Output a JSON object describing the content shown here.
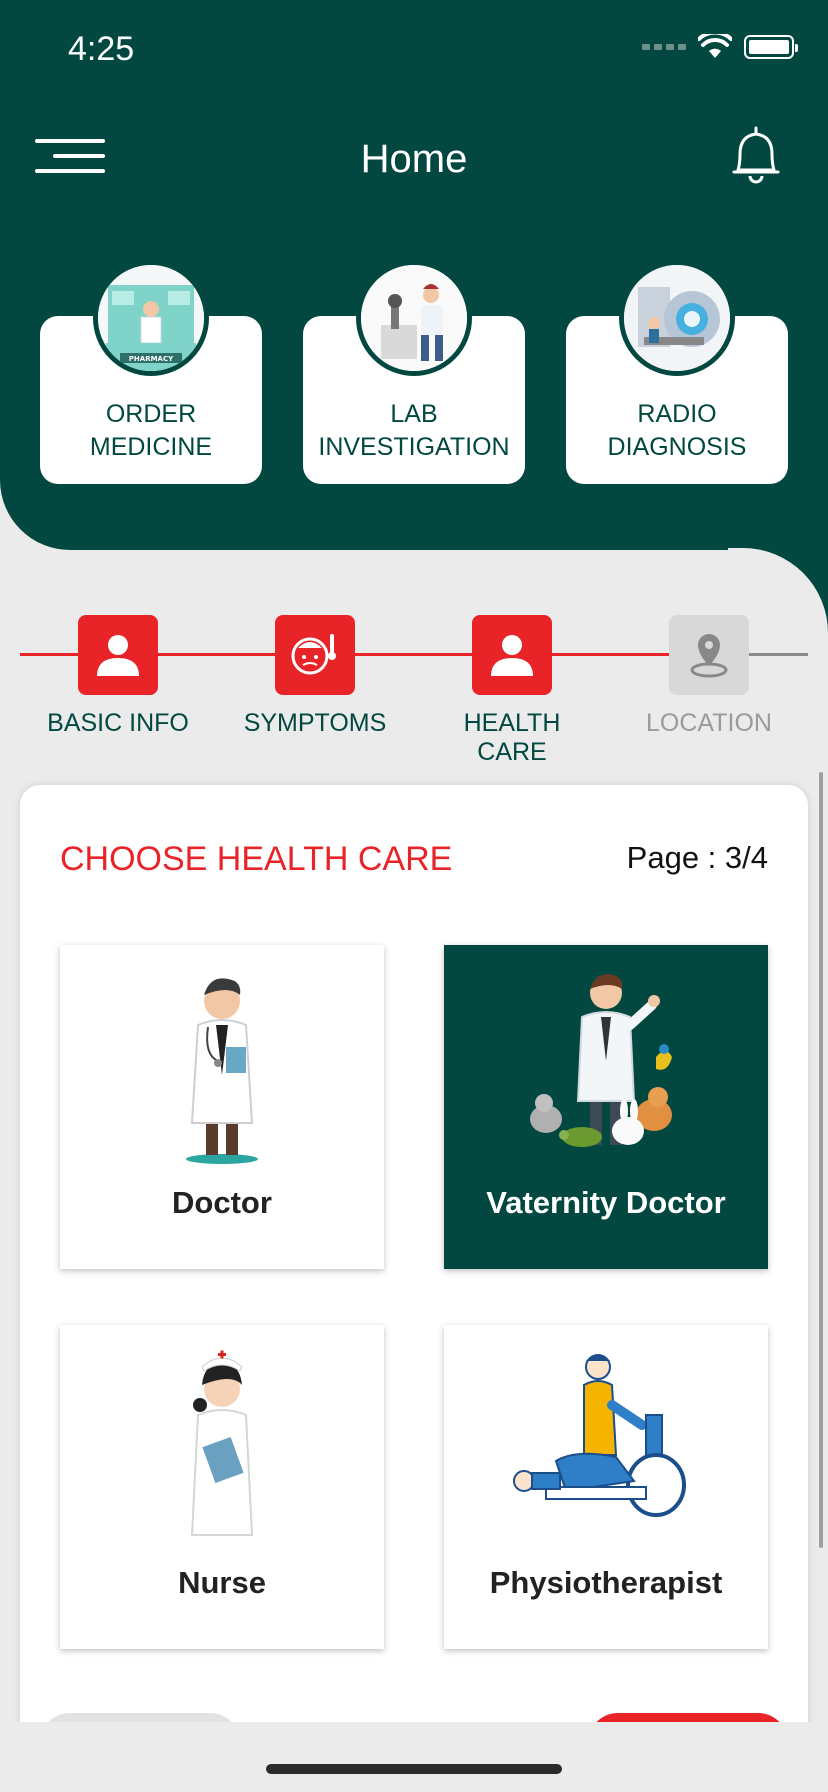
{
  "status_bar": {
    "time": "4:25"
  },
  "header": {
    "title": "Home"
  },
  "services": [
    {
      "label": "ORDER\nMEDICINE",
      "icon": "pharmacy-icon",
      "sign": "PHARMACY"
    },
    {
      "label": "LAB\nINVESTIGATION",
      "icon": "lab-microscope-icon"
    },
    {
      "label": "RADIO\nDIAGNOSIS",
      "icon": "mri-scanner-icon"
    }
  ],
  "stepper": {
    "steps": [
      {
        "label": "BASIC INFO",
        "icon": "user-icon",
        "state": "complete"
      },
      {
        "label": "SYMPTOMS",
        "icon": "fever-face-icon",
        "state": "complete"
      },
      {
        "label": "HEALTH CARE",
        "icon": "user-icon",
        "state": "current"
      },
      {
        "label": "LOCATION",
        "icon": "map-pin-icon",
        "state": "inactive"
      }
    ]
  },
  "card": {
    "title": "CHOOSE HEALTH CARE",
    "page": "Page : 3/4",
    "options": [
      {
        "label": "Doctor",
        "icon": "doctor-illustration",
        "selected": false
      },
      {
        "label": "Vaternity Doctor",
        "icon": "veterinary-doctor-illustration",
        "selected": true
      },
      {
        "label": "Nurse",
        "icon": "nurse-illustration",
        "selected": false
      },
      {
        "label": "Physiotherapist",
        "icon": "physiotherapist-illustration",
        "selected": false
      }
    ]
  },
  "colors": {
    "primary": "#024840",
    "accent": "#e82428",
    "background": "#ebebeb",
    "inactive": "#9a9a9a"
  }
}
